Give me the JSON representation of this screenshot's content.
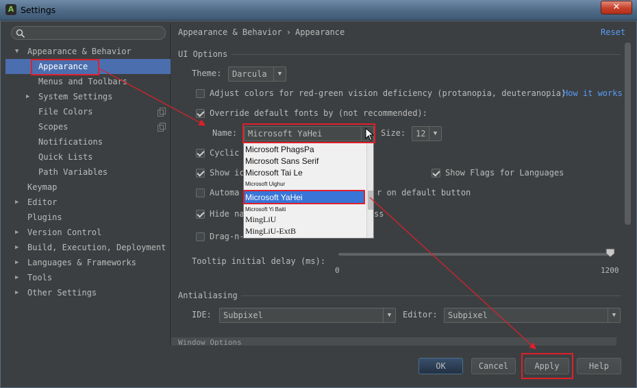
{
  "window": {
    "title": "Settings",
    "close_glyph": "✕"
  },
  "search": {
    "placeholder": ""
  },
  "sidebar": {
    "items": [
      {
        "label": "Appearance & Behavior"
      },
      {
        "label": "Appearance"
      },
      {
        "label": "Menus and Toolbars"
      },
      {
        "label": "System Settings"
      },
      {
        "label": "File Colors"
      },
      {
        "label": "Scopes"
      },
      {
        "label": "Notifications"
      },
      {
        "label": "Quick Lists"
      },
      {
        "label": "Path Variables"
      },
      {
        "label": "Keymap"
      },
      {
        "label": "Editor"
      },
      {
        "label": "Plugins"
      },
      {
        "label": "Version Control"
      },
      {
        "label": "Build, Execution, Deployment"
      },
      {
        "label": "Languages & Frameworks"
      },
      {
        "label": "Tools"
      },
      {
        "label": "Other Settings"
      }
    ]
  },
  "breadcrumb": {
    "parent": "Appearance & Behavior",
    "sep": "›",
    "current": "Appearance"
  },
  "reset_label": "Reset",
  "ui_options": {
    "section_title": "UI Options",
    "theme_label": "Theme:",
    "theme_value": "Darcula",
    "adjust_colors_label": "Adjust colors for red-green vision deficiency (protanopia, deuteranopia)",
    "how_it_works_link": "How it works",
    "override_fonts_label": "Override default fonts by (not recommended):",
    "name_label": "Name:",
    "name_value": "Microsoft YaHei",
    "size_label": "Size:",
    "size_value": "12",
    "cyclic_label": "Cyclic",
    "show_icons_label": "Show ic",
    "show_flags_label": "Show Flags for Languages",
    "auto_label_left": "Automa",
    "auto_label_right": "r on default button",
    "hide_label_left": "Hide na",
    "hide_label_right": "ss",
    "dragn_label": "Drag-n-",
    "tooltip_label": "Tooltip initial delay (ms):",
    "slider_min": "0",
    "slider_max": "1200",
    "slider_value_fraction": 1.0
  },
  "font_dropdown": {
    "items": [
      "Microsoft PhagsPa",
      "Microsoft Sans Serif",
      "Microsoft Tai Le",
      "Microsoft Uighur",
      "Microsoft YaHei",
      "Microsoft Yi Baiti",
      "MingLiU",
      "MingLiU-ExtB"
    ],
    "selected": "Microsoft YaHei"
  },
  "antialiasing": {
    "section_title": "Antialiasing",
    "ide_label": "IDE:",
    "ide_value": "Subpixel",
    "editor_label": "Editor:",
    "editor_value": "Subpixel"
  },
  "window_options": {
    "section_title": "Window Options"
  },
  "footer": {
    "ok": "OK",
    "cancel": "Cancel",
    "apply": "Apply",
    "help": "Help"
  },
  "colors": {
    "accent": "#4b6eaf",
    "link": "#589df6",
    "highlight": "#e0202a"
  }
}
